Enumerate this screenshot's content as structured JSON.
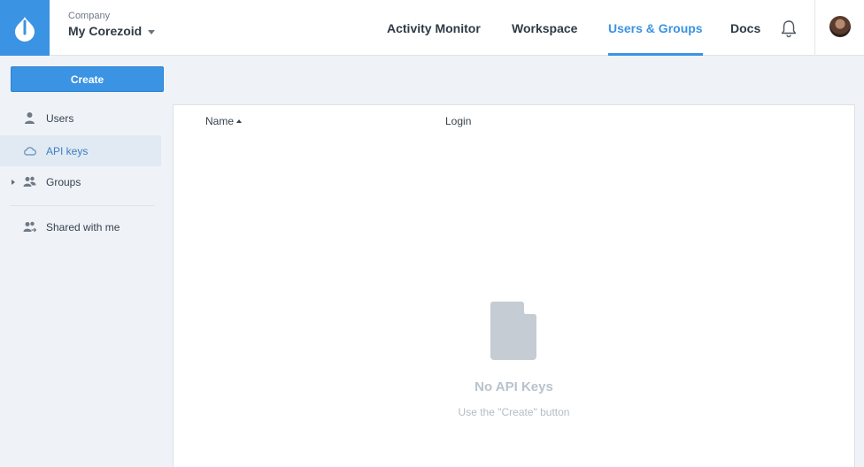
{
  "header": {
    "company_caption": "Company",
    "company_name": "My Corezoid",
    "nav": {
      "activity_monitor": "Activity Monitor",
      "workspace": "Workspace",
      "users_groups": "Users & Groups",
      "docs": "Docs"
    },
    "active_tab": "Users & Groups",
    "icons": [
      "corezoid-logo-icon",
      "chevron-down-icon",
      "bell-icon",
      "avatar"
    ]
  },
  "sidebar": {
    "create_label": "Create",
    "items": [
      {
        "label": "Users",
        "icon": "user-icon",
        "active": false
      },
      {
        "label": "API keys",
        "icon": "cloud-icon",
        "active": true
      },
      {
        "label": "Groups",
        "icon": "group-icon",
        "active": false,
        "expandable": true
      },
      {
        "label": "Shared with me",
        "icon": "shared-icon",
        "active": false
      }
    ]
  },
  "table": {
    "columns": [
      "Name",
      "Login"
    ],
    "sort": {
      "column": "Name",
      "direction": "ascending"
    }
  },
  "empty_state": {
    "icon": "document-icon",
    "title": "No API Keys",
    "subtitle": "Use the \"Create\" button"
  },
  "colors": {
    "accent": "#3b93e3",
    "background": "#eff3f8",
    "active_item_bg": "#e1e9f2",
    "empty_icon": "#c5ccd3"
  }
}
